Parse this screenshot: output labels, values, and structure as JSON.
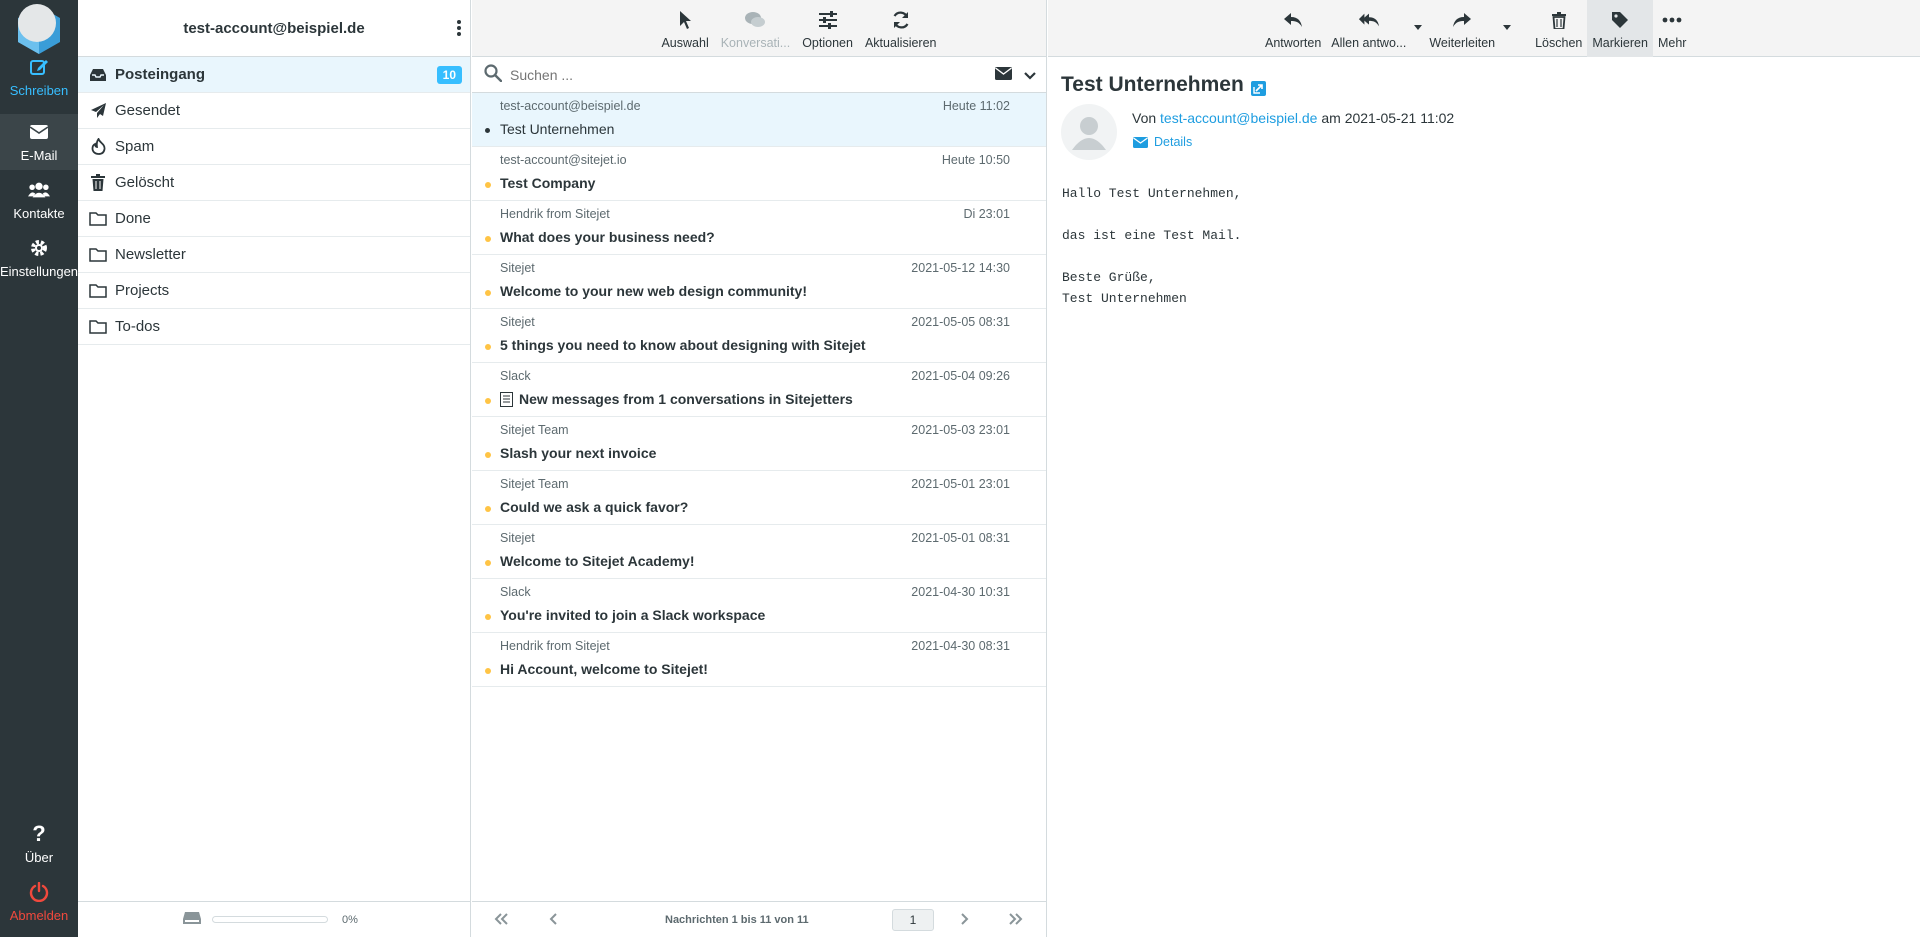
{
  "nav": {
    "compose": "Schreiben",
    "mail": "E-Mail",
    "contacts": "Kontakte",
    "settings": "Einstellungen",
    "about": "Über",
    "logout": "Abmelden"
  },
  "account": "test-account@beispiel.de",
  "folders": [
    {
      "name": "Posteingang",
      "icon": "inbox-icon",
      "unread": "10"
    },
    {
      "name": "Gesendet",
      "icon": "paper-plane-icon"
    },
    {
      "name": "Spam",
      "icon": "fire-icon"
    },
    {
      "name": "Gelöscht",
      "icon": "trash-icon"
    },
    {
      "name": "Done",
      "icon": "folder-icon"
    },
    {
      "name": "Newsletter",
      "icon": "folder-icon"
    },
    {
      "name": "Projects",
      "icon": "folder-icon"
    },
    {
      "name": "To-dos",
      "icon": "folder-icon"
    }
  ],
  "quota": {
    "percent_label": "0%",
    "used_fraction": 0
  },
  "list_toolbar": {
    "select": "Auswahl",
    "threads": "Konversati...",
    "options": "Optionen",
    "refresh": "Aktualisieren"
  },
  "search": {
    "placeholder": "Suchen ..."
  },
  "messages": [
    {
      "from": "test-account@beispiel.de",
      "date": "Heute 11:02",
      "subject": "Test Unternehmen",
      "read": true,
      "selected": true
    },
    {
      "from": "test-account@sitejet.io",
      "date": "Heute 10:50",
      "subject": "Test Company"
    },
    {
      "from": "Hendrik from Sitejet",
      "date": "Di 23:01",
      "subject": "What does your business need?"
    },
    {
      "from": "Sitejet",
      "date": "2021-05-12 14:30",
      "subject": "Welcome to your new web design community!"
    },
    {
      "from": "Sitejet",
      "date": "2021-05-05 08:31",
      "subject": "5 things you need to know about designing with Sitejet"
    },
    {
      "from": "Slack",
      "date": "2021-05-04 09:26",
      "subject": "New messages from 1 conversations in Sitejetters",
      "attachment": true
    },
    {
      "from": "Sitejet Team",
      "date": "2021-05-03 23:01",
      "subject": "Slash your next invoice"
    },
    {
      "from": "Sitejet Team",
      "date": "2021-05-01 23:01",
      "subject": "Could we ask a quick favor?"
    },
    {
      "from": "Sitejet",
      "date": "2021-05-01 08:31",
      "subject": "Welcome to Sitejet Academy!"
    },
    {
      "from": "Slack",
      "date": "2021-04-30 10:31",
      "subject": "You're invited to join a Slack workspace"
    },
    {
      "from": "Hendrik from Sitejet",
      "date": "2021-04-30 08:31",
      "subject": "Hi Account, welcome to Sitejet!"
    }
  ],
  "pager": {
    "text": "Nachrichten 1 bis 11 von 11",
    "page": "1"
  },
  "reader_toolbar": {
    "reply": "Antworten",
    "reply_all": "Allen antwo...",
    "forward": "Weiterleiten",
    "delete": "Löschen",
    "mark": "Markieren",
    "more": "Mehr"
  },
  "message": {
    "subject": "Test Unternehmen",
    "from_prefix": "Von",
    "from": "test-account@beispiel.de",
    "date_prefix": "am",
    "date": "2021-05-21 11:02",
    "details": "Details",
    "body": "Hallo Test Unternehmen,\n\ndas ist eine Test Mail.\n\nBeste Grüße,\nTest Unternehmen"
  },
  "colors": {
    "accent": "#37beff",
    "nav_bg": "#2c363a",
    "unread_dot": "#ffc445",
    "logout": "#f1493d"
  }
}
